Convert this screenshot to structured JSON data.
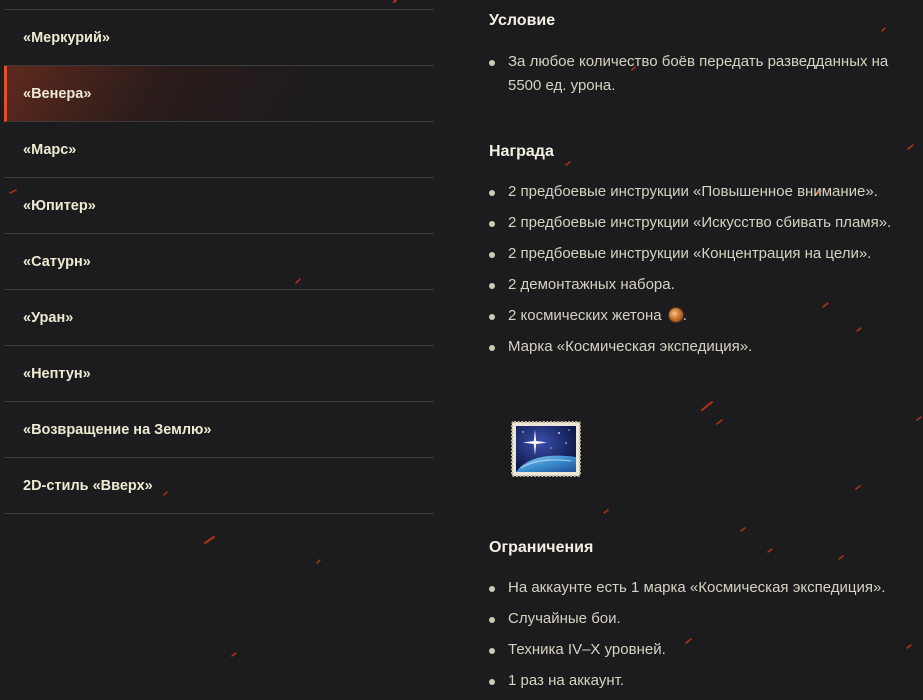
{
  "sidebar": {
    "items": [
      {
        "label": "«Меркурий»",
        "active": false
      },
      {
        "label": "«Венера»",
        "active": true
      },
      {
        "label": "«Марс»",
        "active": false
      },
      {
        "label": "«Юпитер»",
        "active": false
      },
      {
        "label": "«Сатурн»",
        "active": false
      },
      {
        "label": "«Уран»",
        "active": false
      },
      {
        "label": "«Нептун»",
        "active": false
      },
      {
        "label": "«Возвращение на Землю»",
        "active": false
      },
      {
        "label": "2D-стиль «Вверх»",
        "active": false
      }
    ]
  },
  "condition": {
    "title": "Условие",
    "items": [
      "За любое количество боёв передать разведданных на 5500 ед. урона."
    ]
  },
  "reward": {
    "title": "Награда",
    "items": [
      "2 предбоевые инструкции «Повышенное внимание».",
      "2 предбоевые инструкции «Искусство сбивать пламя».",
      "2 предбоевые инструкции «Концентрация на цели».",
      "2 демонтажных набора.",
      {
        "text": "2 космических жетона",
        "suffix": "."
      },
      "Марка «Космическая экспедиция»."
    ],
    "token_icon": "space-token-icon",
    "stamp_icon": "space-expedition-stamp-icon"
  },
  "restrictions": {
    "title": "Ограничения",
    "items": [
      "На аккаунте есть 1 марка «Космическая экспедиция».",
      "Случайные бои.",
      "Техника IV–X уровней.",
      "1 раз на аккаунт."
    ]
  },
  "colors": {
    "background": "#1c1c1e",
    "active_accent": "#e0512b",
    "text": "#d6d2c2",
    "heading": "#f3efe2"
  }
}
